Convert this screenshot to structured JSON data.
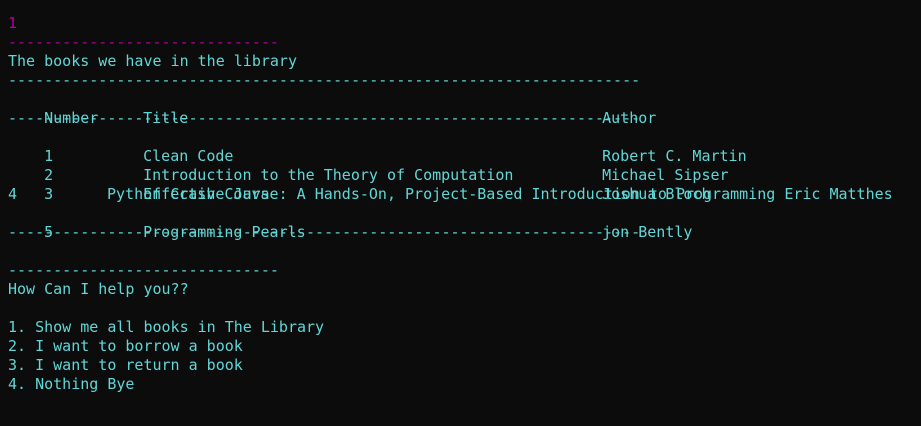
{
  "input_value": "1",
  "magenta_rule": "------------------------------",
  "header_text": "The books we have in the library",
  "table_rule": "----------------------------------------------------------------------",
  "table": {
    "columns": [
      "Number",
      "Title",
      "Author"
    ],
    "rows": [
      {
        "number": "1",
        "title": "Clean Code",
        "author": "Robert C. Martin"
      },
      {
        "number": "2",
        "title": "Introduction to the Theory of Computation",
        "author": "Michael Sipser"
      },
      {
        "number": "3",
        "title": "Effective Java",
        "author": "Joshua Bloch"
      },
      {
        "number": "4",
        "title": "Python Crash Course: A Hands-On, Project-Based Introduction to Programming",
        "author": "Eric Matthes"
      },
      {
        "number": "5",
        "title": "Programming Pearls",
        "author": "jon Bently"
      }
    ]
  },
  "menu_rule": "------------------------------",
  "menu_prompt": "How Can I help you??",
  "menu_options": [
    "1. Show me all books in The Library",
    "2. I want to borrow a book",
    "3. I want to return a book",
    "4. Nothing Bye"
  ],
  "colors": {
    "background": "#0c0c0c",
    "text": "#61d6d6",
    "input": "#b4009e"
  }
}
